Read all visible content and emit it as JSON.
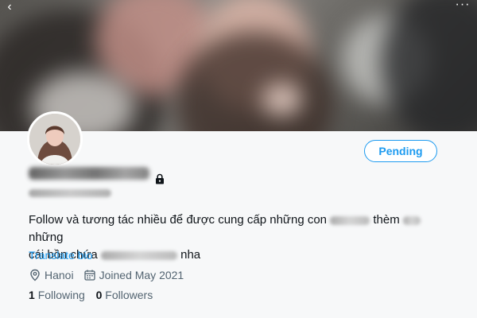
{
  "header": {
    "back_glyph": "‹",
    "more_glyph": "···"
  },
  "profile": {
    "pending_label": "Pending",
    "bio": {
      "part1": "Follow và tương tác nhiều để được cung cấp những con",
      "part2": "thèm",
      "part3": "những",
      "part4": "cái bồn chứa",
      "part5": "nha"
    },
    "translate_label": "Translate bio",
    "location": "Hanoi",
    "joined": "Joined May 2021",
    "following_count": "1",
    "following_label": "Following",
    "followers_count": "0",
    "followers_label": "Followers"
  },
  "icons": {
    "back": "chevron-left-icon",
    "more": "more-icon",
    "lock": "lock-icon",
    "location": "location-pin-icon",
    "calendar": "calendar-icon"
  },
  "colors": {
    "accent": "#1d9bf0",
    "muted": "#536471",
    "text": "#0f1419"
  }
}
